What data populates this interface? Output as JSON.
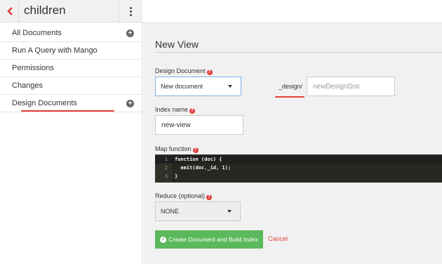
{
  "sidebar": {
    "db_name": "children",
    "items": [
      {
        "label": "All Documents",
        "has_add": true
      },
      {
        "label": "Run A Query with Mango",
        "has_add": false
      },
      {
        "label": "Permissions",
        "has_add": false
      },
      {
        "label": "Changes",
        "has_add": false
      },
      {
        "label": "Design Documents",
        "has_add": true
      }
    ]
  },
  "icons": {
    "back": "chevron-left-icon",
    "menu": "vertical-dots-icon",
    "add": "plus-circle-icon",
    "help": "question-circle-icon",
    "check": "check-circle-icon"
  },
  "main": {
    "title": "New View",
    "design_doc_label": "Design Document",
    "design_doc_value": "New document",
    "design_prefix": "_design/",
    "design_name_placeholder": "newDesignDoc",
    "index_name_label": "Index name",
    "index_name_value": "new-view",
    "map_function_label": "Map function",
    "code_lines": [
      {
        "num": "1",
        "text": "function (doc) {"
      },
      {
        "num": "2",
        "text": "  emit(doc._id, 1);"
      },
      {
        "num": "3",
        "text": "}"
      }
    ],
    "reduce_label": "Reduce (optional)",
    "reduce_value": "NONE",
    "create_button": "Create Document and Build Index",
    "cancel": "Cancel"
  },
  "colors": {
    "accent": "#e33f3b",
    "success": "#5cb85c",
    "code_bg": "#272822"
  }
}
